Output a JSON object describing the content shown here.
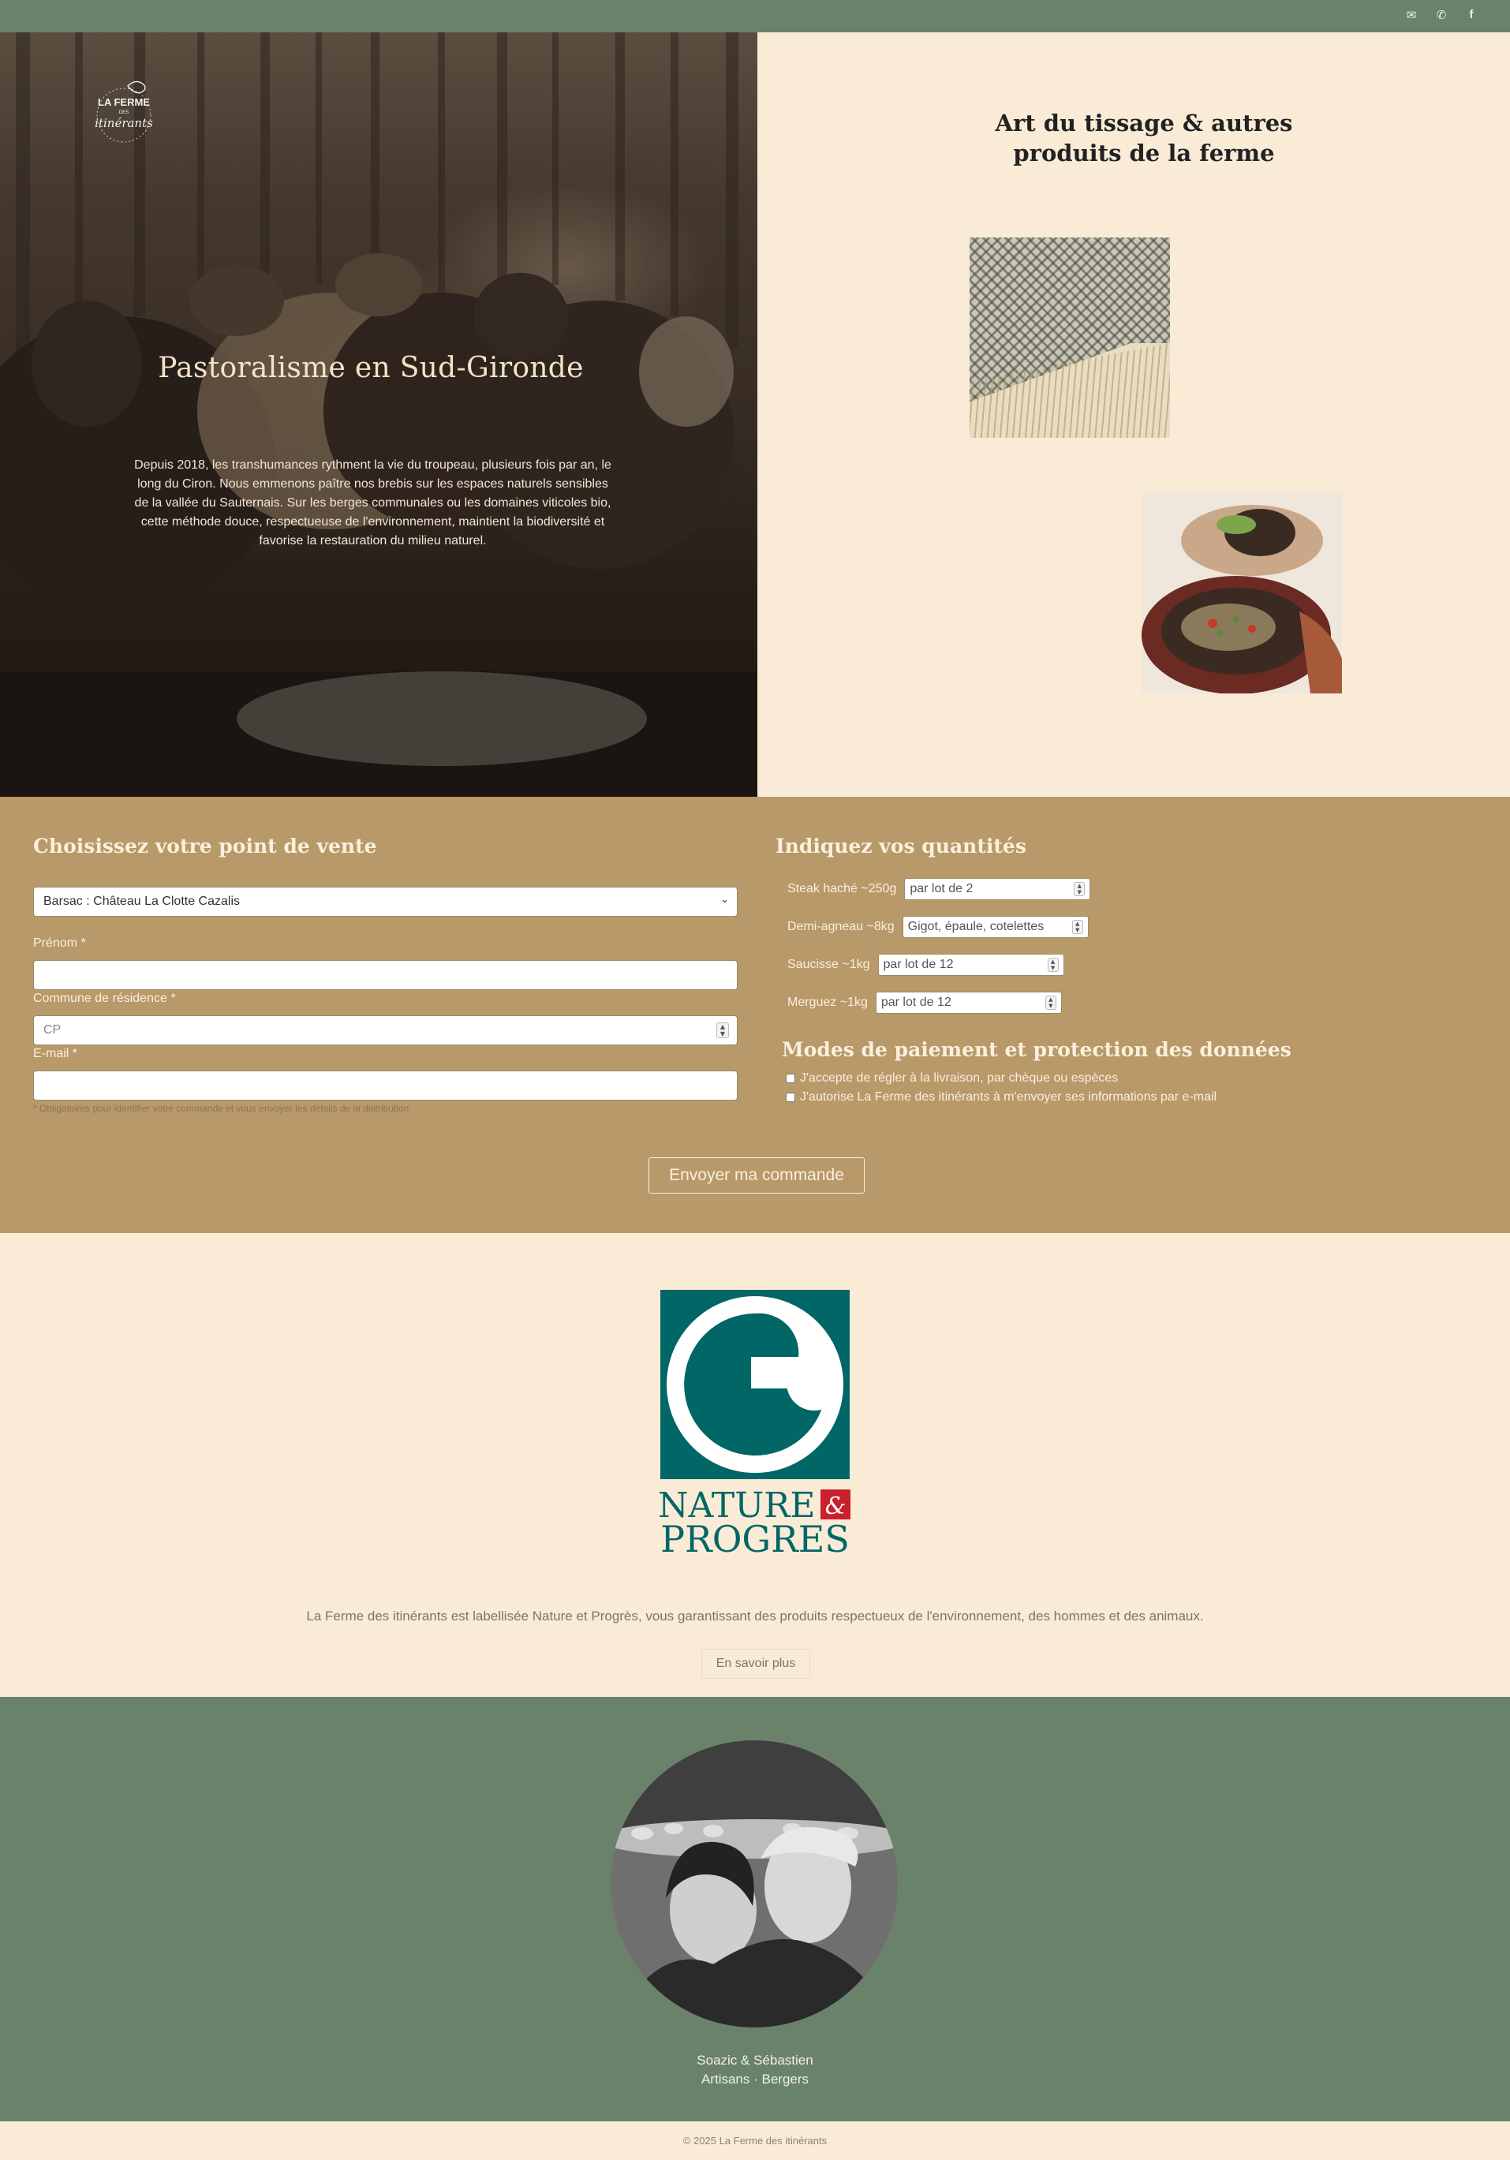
{
  "topbar": {
    "icons": [
      "envelope-icon",
      "whatsapp-icon",
      "facebook-icon"
    ],
    "color": "#6b826a"
  },
  "brand": {
    "logo_line1": "LA FERME",
    "logo_line2": "DES",
    "logo_line3": "itinérants"
  },
  "hero": {
    "title": "Pastoralisme en Sud-Gironde",
    "text": "Depuis 2018, les transhumances rythment la vie du troupeau, plusieurs fois par an, le long du Ciron. Nous emmenons paître nos brebis sur les espaces naturels sensibles de la vallée du Sauternais. Sur les berges communales ou les domaines viticoles bio, cette méthode douce, respectueuse de l'environnement, maintient la biodiversité et favorise la restauration du milieu naturel."
  },
  "products": {
    "title": "Art du tissage & autres produits de la ferme",
    "images": [
      "woven-blanket-photo",
      "farm-dish-photo"
    ]
  },
  "order": {
    "point_title": "Choisissez votre point de vente",
    "point_value": "Barsac : Château La Clotte Cazalis",
    "firstname_label": "Prénom *",
    "firstname_value": "",
    "commune_label": "Commune de résidence *",
    "commune_placeholder": "CP",
    "email_label": "E-mail *",
    "email_value": "",
    "required_note": "* Obligatoires pour identifier votre commande et vous envoyer les détails de la distribution",
    "qty_title": "Indiquez vos quantités",
    "quantities": [
      {
        "label": "Steak haché ~250g",
        "placeholder": "par lot de 2"
      },
      {
        "label": "Demi-agneau ~8kg",
        "placeholder": "Gigot, épaule, cotelettes"
      },
      {
        "label": "Saucisse ~1kg",
        "placeholder": "par lot de 12"
      },
      {
        "label": "Merguez ~1kg",
        "placeholder": "par lot de 12"
      }
    ],
    "payment_title": "Modes de paiement et protection des données",
    "checkboxes": [
      {
        "label": "J'accepte de régler à la livraison, par chèque ou espèces",
        "checked": false
      },
      {
        "label": "J'autorise La Ferme des itinérants à m'envoyer ses informations par e-mail",
        "checked": false
      }
    ],
    "submit": "Envoyer ma commande",
    "color": "#b8996a"
  },
  "label": {
    "logo_word1": "NATURE",
    "logo_amp": "&",
    "logo_word2": "PROGRES",
    "logo_color": "#006666",
    "text": "La Ferme des itinérants est labellisée Nature et Progrès, vous garantissant des produits respectueux de l'environnement, des hommes et des animaux.",
    "more": "En savoir plus"
  },
  "team": {
    "names": "Soazic & Sébastien",
    "roles": "Artisans · Bergers"
  },
  "footer": {
    "copyright": "© 2025 La Ferme des itinérants"
  }
}
